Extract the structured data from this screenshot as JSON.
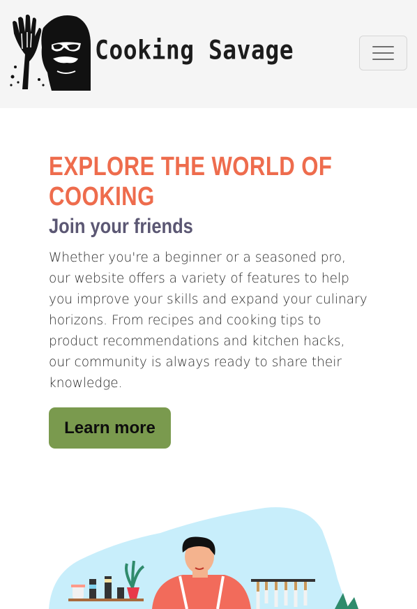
{
  "navbar": {
    "brand": "Cooking Savage",
    "toggler_icon": "hamburger-icon"
  },
  "hero": {
    "title": "EXPLORE THE WORLD OF COOKING",
    "subtitle": "Join your friends",
    "body": "Whether you're a beginner or a seasoned pro, our website offers a variety of features to help you improve your skills and expand your culinary horizons. From recipes and cooking tips to product recommendations and kitchen hacks, our community is always ready to share their knowledge.",
    "cta_label": "Learn more"
  },
  "colors": {
    "accent": "#ee6c4d",
    "subtitle": "#5b5773",
    "cta": "#7a9a4e",
    "navbar_bg": "#f5f5f5"
  }
}
